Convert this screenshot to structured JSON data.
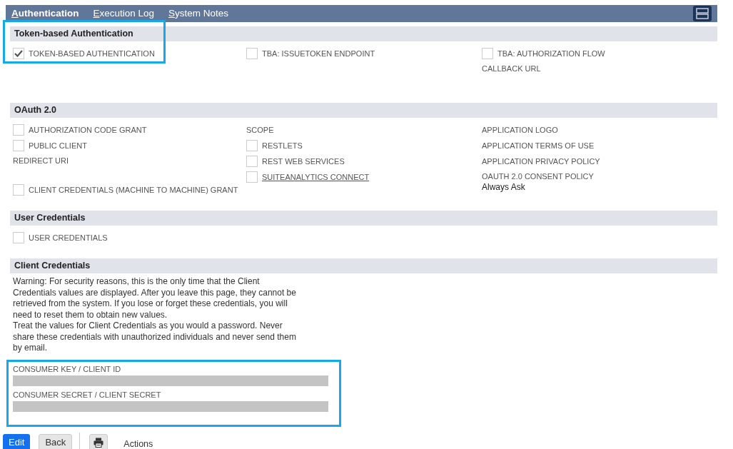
{
  "tabs": [
    {
      "label": "Authentication",
      "selected": true
    },
    {
      "label": "Execution Log",
      "selected": false
    },
    {
      "label": "System Notes",
      "selected": false
    }
  ],
  "sections": [
    {
      "title": "Token-based Authentication",
      "columns": [
        [
          {
            "kind": "checkbox",
            "label": "TOKEN-BASED AUTHENTICATION",
            "checked": true
          }
        ],
        [
          {
            "kind": "checkbox",
            "label": "TBA: ISSUETOKEN ENDPOINT",
            "checked": false
          }
        ],
        [
          {
            "kind": "checkbox",
            "label": "TBA: AUTHORIZATION FLOW",
            "checked": false
          },
          {
            "kind": "field",
            "label": "CALLBACK URL"
          }
        ]
      ]
    },
    {
      "title": "OAuth 2.0",
      "columns": [
        [
          {
            "kind": "checkbox",
            "label": "AUTHORIZATION CODE GRANT",
            "checked": false
          },
          {
            "kind": "checkbox",
            "label": "PUBLIC CLIENT",
            "checked": false
          },
          {
            "kind": "field",
            "label": "REDIRECT URI"
          },
          {
            "kind": "checkbox",
            "label": "CLIENT CREDENTIALS (MACHINE TO MACHINE) GRANT",
            "checked": false
          }
        ],
        [
          {
            "kind": "label",
            "label": "SCOPE"
          },
          {
            "kind": "checkbox",
            "label": "RESTLETS",
            "checked": false
          },
          {
            "kind": "checkbox",
            "label": "REST WEB SERVICES",
            "checked": false
          },
          {
            "kind": "checkbox-link",
            "label": "SUITEANALYTICS CONNECT",
            "checked": false
          }
        ],
        [
          {
            "kind": "label",
            "label": "APPLICATION LOGO"
          },
          {
            "kind": "label",
            "label": "APPLICATION TERMS OF USE"
          },
          {
            "kind": "label",
            "label": "APPLICATION PRIVACY POLICY"
          },
          {
            "kind": "field",
            "label": "OAUTH 2.0 CONSENT POLICY",
            "value": "Always Ask"
          }
        ]
      ]
    },
    {
      "title": "User Credentials",
      "columns": [
        [
          {
            "kind": "checkbox",
            "label": "USER CREDENTIALS",
            "checked": false
          }
        ]
      ]
    }
  ],
  "client_credentials": {
    "title": "Client Credentials",
    "warning": [
      "Warning: For security reasons, this is the only time that the Client Credentials values are displayed. After you leave this page, they cannot be retrieved from the system. If you lose or forget these credentials, you will need to reset them to obtain new values.",
      "Treat the values for Client Credentials as you would a password. Never share these credentials with unauthorized individuals and never send them by email."
    ],
    "fields": [
      {
        "label": "CONSUMER KEY / CLIENT ID"
      },
      {
        "label": "CONSUMER SECRET / CLIENT SECRET"
      }
    ]
  },
  "buttons": {
    "edit": "Edit",
    "back": "Back",
    "actions": "Actions"
  }
}
